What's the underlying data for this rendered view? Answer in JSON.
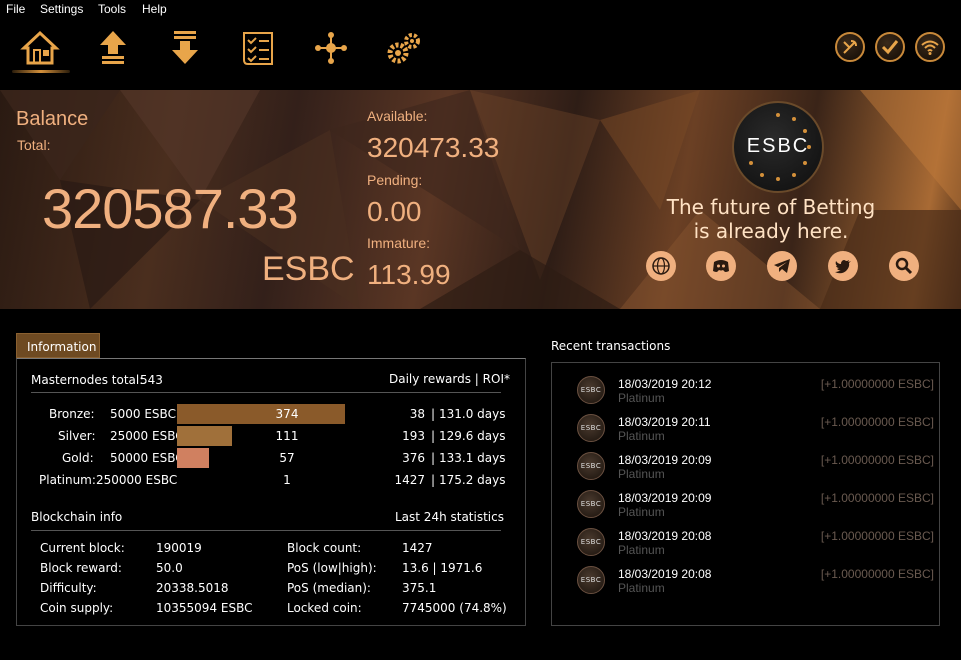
{
  "menu": [
    "File",
    "Settings",
    "Tools",
    "Help"
  ],
  "toolbar": {
    "icons": [
      "home-icon",
      "send-icon",
      "receive-icon",
      "transactions-icon",
      "masternodes-icon",
      "settings-icon"
    ],
    "status_icons": [
      "staking-icon",
      "synced-check-icon",
      "network-wifi-icon"
    ]
  },
  "balance": {
    "title": "Balance",
    "total_label": "Total:",
    "total": "320587.33",
    "unit": "ESBC",
    "available_label": "Available:",
    "available": "320473.33",
    "pending_label": "Pending:",
    "pending": "0.00",
    "immature_label": "Immature:",
    "immature": "113.99"
  },
  "brand": {
    "logo_text": "ESBC",
    "slogan_line1": "The future of Betting",
    "slogan_line2": "is already here.",
    "social": [
      "website-globe-icon",
      "discord-icon",
      "telegram-icon",
      "twitter-icon",
      "search-icon"
    ]
  },
  "info": {
    "tab_label": "Information",
    "mn_total_label": "Masternodes total:",
    "mn_total": "543",
    "daily_header": "Daily rewards | ROI*",
    "tiers": [
      {
        "label": "Bronze:",
        "collateral": "5000 ESBC",
        "count": "374",
        "count_value": 374,
        "reward": "38",
        "roi": "131.0 days",
        "color": "#8a5a2a"
      },
      {
        "label": "Silver:",
        "collateral": "25000 ESBC",
        "count": "111",
        "count_value": 111,
        "reward": "193",
        "roi": "129.6 days",
        "color": "#a0703a"
      },
      {
        "label": "Gold:",
        "collateral": "50000 ESBC",
        "count": "57",
        "count_value": 57,
        "reward": "376",
        "roi": "133.1 days",
        "color": "#d08060"
      },
      {
        "label": "Platinum:",
        "collateral": "250000 ESBC",
        "count": "1",
        "count_value": 1,
        "reward": "1427",
        "roi": "175.2 days",
        "color": "#c0c0c0"
      }
    ],
    "blockchain_title": "Blockchain info",
    "stats_title": "Last 24h statistics",
    "left_stats": [
      {
        "label": "Current block:",
        "value": "190019"
      },
      {
        "label": "Block reward:",
        "value": "50.0"
      },
      {
        "label": "Difficulty:",
        "value": "20338.5018"
      },
      {
        "label": "Coin supply:",
        "value": "10355094 ESBC"
      }
    ],
    "right_stats": [
      {
        "label": "Block count:",
        "value": "1427"
      },
      {
        "label": "PoS (low|high):",
        "value": "13.6 | 1971.6"
      },
      {
        "label": "PoS (median):",
        "value": "375.1"
      },
      {
        "label": "Locked coin:",
        "value": "7745000 (74.8%)"
      }
    ]
  },
  "recent": {
    "title": "Recent transactions",
    "items": [
      {
        "date": "18/03/2019 20:12",
        "type": "Platinum",
        "amount": "[+1.00000000 ESBC]"
      },
      {
        "date": "18/03/2019 20:11",
        "type": "Platinum",
        "amount": "[+1.00000000 ESBC]"
      },
      {
        "date": "18/03/2019 20:09",
        "type": "Platinum",
        "amount": "[+1.00000000 ESBC]"
      },
      {
        "date": "18/03/2019 20:09",
        "type": "Platinum",
        "amount": "[+1.00000000 ESBC]"
      },
      {
        "date": "18/03/2019 20:08",
        "type": "Platinum",
        "amount": "[+1.00000000 ESBC]"
      },
      {
        "date": "18/03/2019 20:08",
        "type": "Platinum",
        "amount": "[+1.00000000 ESBC]"
      }
    ]
  },
  "colors": {
    "accent": "#f0b07f",
    "icon_gold": "#e8a54a"
  }
}
